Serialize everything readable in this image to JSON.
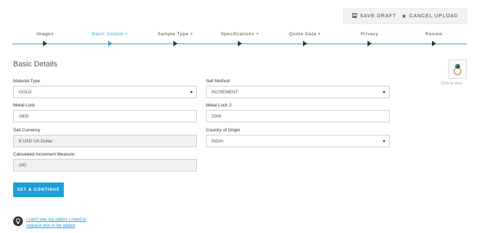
{
  "toolbar": {
    "save_draft": "SAVE DRAFT",
    "cancel_upload": "CANCEL UPLOAD"
  },
  "steps": [
    {
      "label": "Images",
      "active": false
    },
    {
      "label": "Basic Details +",
      "active": true
    },
    {
      "label": "Sample Type +",
      "active": false
    },
    {
      "label": "Specifications +",
      "active": false
    },
    {
      "label": "Quote Data +",
      "active": false
    },
    {
      "label": "Privacy",
      "active": false
    },
    {
      "label": "Review",
      "active": false
    }
  ],
  "page": {
    "title": "Basic Details",
    "thumbnail_caption": "Click to view"
  },
  "form": {
    "material_type": {
      "label": "Material Type",
      "value": "GOLD"
    },
    "sell_method": {
      "label": "Sell Method",
      "value": "INCREMENT"
    },
    "metal_lock": {
      "label": "Metal Lock",
      "value": "1800"
    },
    "metal_lock_2": {
      "label": "Metal Lock 2",
      "value": "2000"
    },
    "sell_currency": {
      "label": "Sell Currency",
      "value": "$ USD US Dollar"
    },
    "country_of_origin": {
      "label": "Country of Origin",
      "value": "INDIA"
    },
    "calculated_increment_measure": {
      "label": "Calculated Increment Measure",
      "value": "200"
    }
  },
  "actions": {
    "submit": "SET & CONTINUE",
    "help_link": "I can't see my option I need to request one to be added"
  },
  "colors": {
    "accent": "#2aa8c9",
    "button": "#1a9fd7",
    "readonly_bg": "#f1f1f1"
  },
  "icons": {
    "save": "floppy-disk-icon",
    "cancel": "close-icon",
    "help": "lightbulb-icon",
    "thumbnail": "ring-thumbnail"
  }
}
